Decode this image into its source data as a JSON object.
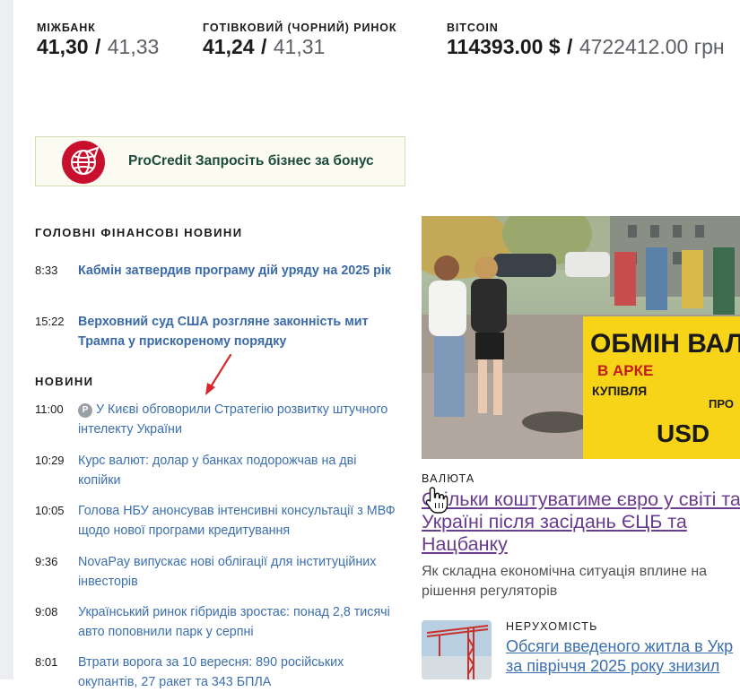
{
  "rates": [
    {
      "label": "МІЖБАНК",
      "buy": "41,30",
      "sell": "41,33"
    },
    {
      "label": "ГОТІВКОВИЙ (ЧОРНИЙ) РИНОК",
      "buy": "41,24",
      "sell": "41,31"
    },
    {
      "label": "BITCOIN",
      "buy": "114393.00 $",
      "sell": "4722412.00 грн"
    }
  ],
  "rate_separator": "/",
  "banner": {
    "text": "ProCredit Запросіть бізнес за бонус"
  },
  "sections": {
    "main_news": "ГОЛОВНІ ФІНАНСОВІ НОВИНИ",
    "news": "НОВИНИ"
  },
  "main_news": [
    {
      "time": "8:33",
      "title": "Кабмін затвердив програму дій уряду на 2025 рік"
    },
    {
      "time": "15:22",
      "title": "Верховний суд США розгляне законність мит Трампа у прискореному порядку"
    }
  ],
  "news": [
    {
      "time": "11:00",
      "badge": "P",
      "title": "У Києві обговорили Стратегію розвитку штучного інтелекту України"
    },
    {
      "time": "10:29",
      "title": "Курс валют: долар у банках подорожчав на дві копійки"
    },
    {
      "time": "10:05",
      "title": "Голова НБУ анонсував інтенсивні консультації з МВФ щодо нової програми кредитування"
    },
    {
      "time": "9:36",
      "title": "NovaPay випускає нові облігації для інституційних інвесторів"
    },
    {
      "time": "9:08",
      "title": "Український ринок гібридів зростає: понад 2,8 тисячі авто поповнили парк у серпні"
    },
    {
      "time": "8:01",
      "title": "Втрати ворога за 10 вересня: 890 російських окупантів, 27 ракет та 343 БПЛА"
    }
  ],
  "featured": {
    "category": "ВАЛЮТА",
    "title_lines": [
      "Скільки коштуватиме євро у світі та",
      "Україні після засідань ЄЦБ та",
      "Нацбанку"
    ],
    "lead_lines": [
      "Як складна економічна ситуація вплине на",
      "рішення регуляторів"
    ],
    "sign": {
      "line1": "ОБМІН ВАЛЮТ",
      "line2": "В АРКЕ",
      "line3": "КУПІВЛЯ",
      "line4": "ПРО",
      "line5": "USD"
    }
  },
  "card": {
    "category": "НЕРУХОМІСТЬ",
    "title_lines": [
      "Обсяги введеного житла в Укр",
      "за півріччя 2025 року знизил"
    ]
  },
  "colors": {
    "link": "#3c6fae",
    "visited_link": "#6a3c8f",
    "banner_bg": "#fbfbf1",
    "sign_yellow": "#f7d417",
    "logo_red": "#c8102e"
  },
  "icons": {
    "cursor": "hand-pointer-icon",
    "arrow": "red-arrow-annotation",
    "logo": "procredit-globe-icon"
  }
}
